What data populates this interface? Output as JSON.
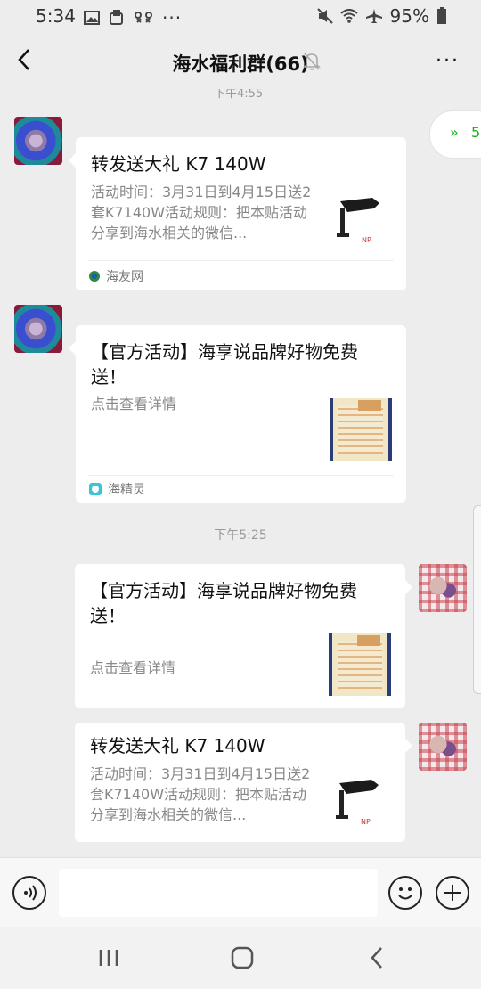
{
  "status_bar": {
    "time": "5:34",
    "battery_percent": "95%",
    "left_icons": [
      "image-icon",
      "clipboard-icon",
      "game-controller-icon",
      "more-dots-icon"
    ],
    "right_icons": [
      "mute-icon",
      "wifi-icon",
      "airplane-icon",
      "battery-icon"
    ]
  },
  "nav": {
    "title": "海水福利群(66)",
    "back_icon": "chevron-left-icon",
    "mute_icon": "bell-off-icon",
    "more_label": "···"
  },
  "unread_pill": {
    "label": "5",
    "icon": "double-chevron-up-icon"
  },
  "messages": [
    {
      "side": "left",
      "title": "转发送大礼 K7 140W",
      "desc": "活动时间：3月31日到4月15日送2套K7140W活动规则：把本贴活动分享到海水相关的微信...",
      "source": "海友网",
      "thumb": "lamp"
    },
    {
      "side": "left",
      "title": "【官方活动】海享说品牌好物免费送！",
      "desc": "点击查看详情",
      "source": "海精灵",
      "thumb": "box"
    },
    {
      "side": "right",
      "title": "【官方活动】海享说品牌好物免费送！",
      "desc": "点击查看详情",
      "thumb": "box"
    },
    {
      "side": "right",
      "title": "转发送大礼 K7 140W",
      "desc": "活动时间：3月31日到4月15日送2套K7140W活动规则：把本贴活动分享到海水相关的微信...",
      "thumb": "lamp"
    }
  ],
  "time_separator": "下午5:25",
  "colors": {
    "background": "#ededed",
    "accent_green": "#1aad19",
    "card": "#ffffff"
  }
}
